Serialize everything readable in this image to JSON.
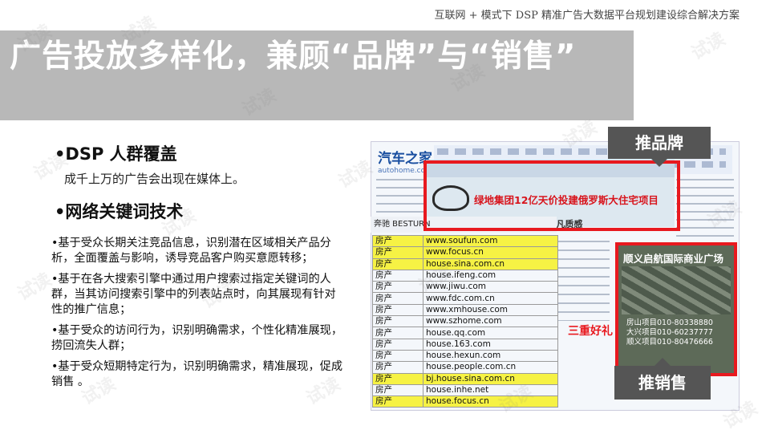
{
  "header": {
    "caption": "互联网 + 模式下 DSP 精准广告大数据平台规划建设综合解决方案",
    "title": "广告投放多样化，兼顾“品牌”与“销售”"
  },
  "left": {
    "heading1": "•DSP 人群覆盖",
    "sub1": "成千上万的广告会出现在媒体上。",
    "heading2": "•网络关键词技术",
    "bullets": [
      "•基于受众长期关注竞品信息，识别潜在区域相关产品分析，全面覆盖与影响，诱导竞品客户购买意愿转移；",
      "•基于在各大搜索引擎中通过用户搜索过指定关键词的人群，当其访问搜索引擎中的列表站点时，向其展现有针对性的推广信息；",
      "•基于受众的访问行为，识别明确需求，个性化精准展现，捞回流失人群；",
      "•基于受众短期特定行为，识别明确需求，精准展现，促成销售 。"
    ]
  },
  "screenshot": {
    "site_logo": "汽车之家",
    "site_logo_sub": "autohome.com.cn",
    "banner_text": "绿地集团12亿天价投建俄罗斯大住宅项目",
    "slogan": "我选择  非凡质感",
    "header_strip": "奔驰  BESTURN",
    "ad_title": "顺义启航国际商业广场",
    "ad_phone_1": "房山项目010-80338880",
    "ad_phone_2": "大兴项目010-60237777",
    "ad_phone_3": "顺义项目010-80476666",
    "promo": "三重好礼"
  },
  "labels": {
    "brand": "推品牌",
    "sales": "推销售"
  },
  "sites_table": {
    "rows": [
      {
        "cat": "房产",
        "url": "www.soufun.com",
        "hl": true
      },
      {
        "cat": "房产",
        "url": "www.focus.cn",
        "hl": true
      },
      {
        "cat": "房产",
        "url": "house.sina.com.cn",
        "hl": true
      },
      {
        "cat": "房产",
        "url": "house.ifeng.com",
        "hl": false
      },
      {
        "cat": "房产",
        "url": "www.jiwu.com",
        "hl": false
      },
      {
        "cat": "房产",
        "url": "www.fdc.com.cn",
        "hl": false
      },
      {
        "cat": "房产",
        "url": "www.xmhouse.com",
        "hl": false
      },
      {
        "cat": "房产",
        "url": "www.szhome.com",
        "hl": false
      },
      {
        "cat": "房产",
        "url": "house.qq.com",
        "hl": false
      },
      {
        "cat": "房产",
        "url": "house.163.com",
        "hl": false
      },
      {
        "cat": "房产",
        "url": "house.hexun.com",
        "hl": false
      },
      {
        "cat": "房产",
        "url": "house.people.com.cn",
        "hl": false
      },
      {
        "cat": "房产",
        "url": "bj.house.sina.com.cn",
        "hl": true
      },
      {
        "cat": "房产",
        "url": "house.inhe.net",
        "hl": false
      },
      {
        "cat": "房产",
        "url": "house.focus.cn",
        "hl": true
      }
    ]
  },
  "watermark": "试读"
}
